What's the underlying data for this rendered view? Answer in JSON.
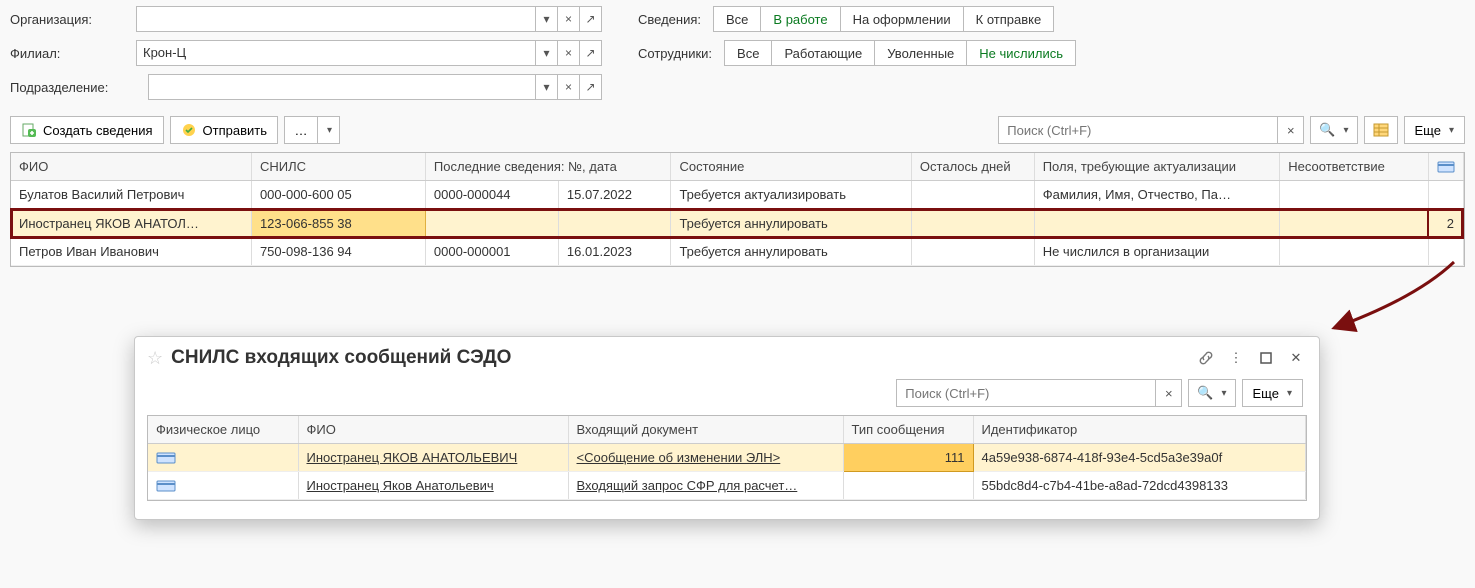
{
  "filters": {
    "org_label": "Организация:",
    "org_value": "",
    "branch_label": "Филиал:",
    "branch_value": "Крон-Ц",
    "dept_label": "Подразделение:",
    "dept_value": "",
    "info_label": "Сведения:",
    "info_options": [
      "Все",
      "В работе",
      "На оформлении",
      "К отправке"
    ],
    "info_active_index": 1,
    "emp_label": "Сотрудники:",
    "emp_options": [
      "Все",
      "Работающие",
      "Уволенные",
      "Не числились"
    ],
    "emp_active_index": 3
  },
  "toolbar": {
    "create_label": "Создать сведения",
    "send_label": "Отправить",
    "search_placeholder": "Поиск (Ctrl+F)",
    "more_label": "Еще"
  },
  "main_table": {
    "headers": [
      "ФИО",
      "СНИЛС",
      "Последние сведения: №, дата",
      "",
      "Состояние",
      "Осталось дней",
      "Поля, требующие актуализации",
      "Несоответствие",
      ""
    ],
    "rows": [
      {
        "fio": "Булатов Василий Петрович",
        "snils": "000-000-600 05",
        "doc_no": "0000-000044",
        "doc_date": "15.07.2022",
        "state": "Требуется актуализировать",
        "days": "",
        "fields": "Фамилия, Имя, Отчество, Па…",
        "mismatch": "",
        "badge": ""
      },
      {
        "fio": "Иностранец ЯКОВ АНАТОЛ…",
        "snils": "123-066-855 38",
        "doc_no": "",
        "doc_date": "",
        "state": "Требуется аннулировать",
        "days": "",
        "fields": "",
        "mismatch": "",
        "badge": "2",
        "selected": true
      },
      {
        "fio": "Петров Иван Иванович",
        "snils": "750-098-136 94",
        "doc_no": "0000-000001",
        "doc_date": "16.01.2023",
        "state": "Требуется аннулировать",
        "days": "",
        "fields": "Не числился в организации",
        "mismatch": "",
        "badge": ""
      }
    ]
  },
  "popup": {
    "title": "СНИЛС входящих сообщений СЭДО",
    "search_placeholder": "Поиск (Ctrl+F)",
    "more_label": "Еще",
    "headers": [
      "Физическое лицо",
      "ФИО",
      "Входящий документ",
      "Тип сообщения",
      "Идентификатор"
    ],
    "rows": [
      {
        "fio": "Иностранец ЯКОВ АНАТОЛЬЕВИЧ",
        "doc": "<Сообщение об изменении ЭЛН>",
        "type": "111",
        "id": "4a59e938-6874-418f-93e4-5cd5a3e39a0f",
        "selected": true
      },
      {
        "fio": "Иностранец Яков Анатольевич",
        "doc": "Входящий запрос СФР для расчет…",
        "type": "",
        "id": "55bdc8d4-c7b4-41be-a8ad-72dcd4398133"
      }
    ]
  }
}
